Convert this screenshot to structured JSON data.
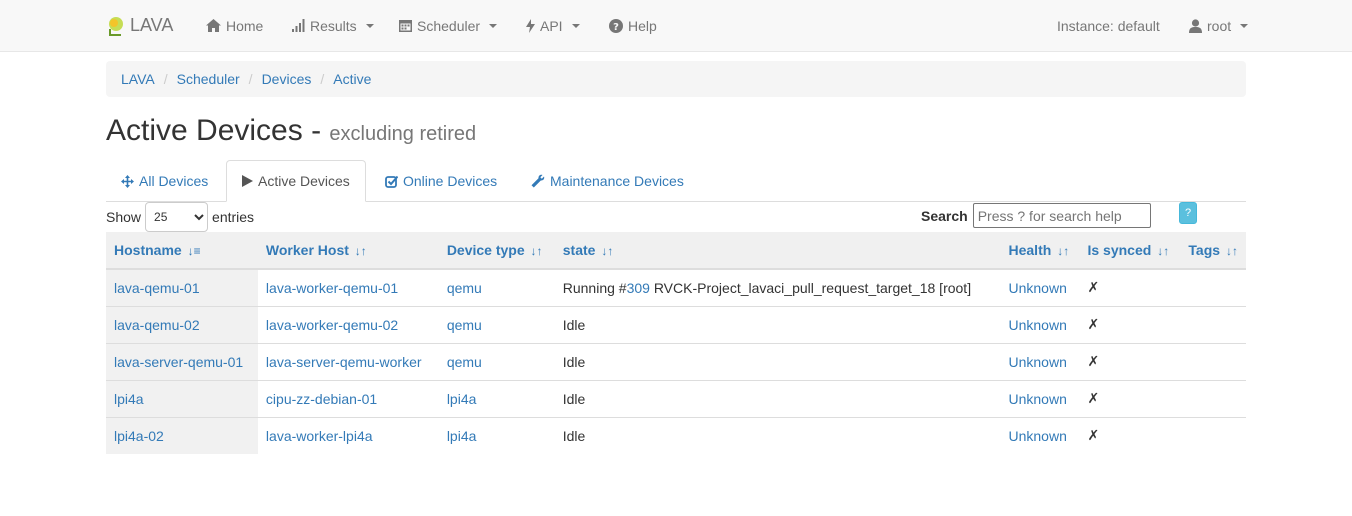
{
  "navbar": {
    "brand": "LAVA",
    "home": "Home",
    "results": "Results",
    "scheduler": "Scheduler",
    "api": "API",
    "help": "Help",
    "instance": "Instance: default",
    "user": "root"
  },
  "breadcrumb": [
    "LAVA",
    "Scheduler",
    "Devices",
    "Active"
  ],
  "page": {
    "title": "Active Devices -",
    "subtitle": "excluding retired"
  },
  "tabs": [
    "All Devices",
    "Active Devices",
    "Online Devices",
    "Maintenance Devices"
  ],
  "table_controls": {
    "show": "Show",
    "entries_value": "25",
    "entries": "entries",
    "search_label": "Search",
    "search_placeholder": "Press ? for search help",
    "help": "?"
  },
  "table": {
    "columns": [
      "Hostname",
      "Worker Host",
      "Device type",
      "state",
      "Health",
      "Is synced",
      "Tags"
    ],
    "rows": [
      {
        "hostname": "lava-qemu-01",
        "worker": "lava-worker-qemu-01",
        "type": "qemu",
        "state_prefix": "Running #",
        "job_id": "309",
        "state_suffix": " RVCK-Project_lavaci_pull_request_target_18 [root]",
        "health": "Unknown",
        "synced": "✗",
        "tags": ""
      },
      {
        "hostname": "lava-qemu-02",
        "worker": "lava-worker-qemu-02",
        "type": "qemu",
        "state_prefix": "Idle",
        "job_id": "",
        "state_suffix": "",
        "health": "Unknown",
        "synced": "✗",
        "tags": ""
      },
      {
        "hostname": "lava-server-qemu-01",
        "worker": "lava-server-qemu-worker",
        "type": "qemu",
        "state_prefix": "Idle",
        "job_id": "",
        "state_suffix": "",
        "health": "Unknown",
        "synced": "✗",
        "tags": ""
      },
      {
        "hostname": "lpi4a",
        "worker": "cipu-zz-debian-01",
        "type": "lpi4a",
        "state_prefix": "Idle",
        "job_id": "",
        "state_suffix": "",
        "health": "Unknown",
        "synced": "✗",
        "tags": ""
      },
      {
        "hostname": "lpi4a-02",
        "worker": "lava-worker-lpi4a",
        "type": "lpi4a",
        "state_prefix": "Idle",
        "job_id": "",
        "state_suffix": "",
        "health": "Unknown",
        "synced": "✗",
        "tags": ""
      }
    ]
  }
}
